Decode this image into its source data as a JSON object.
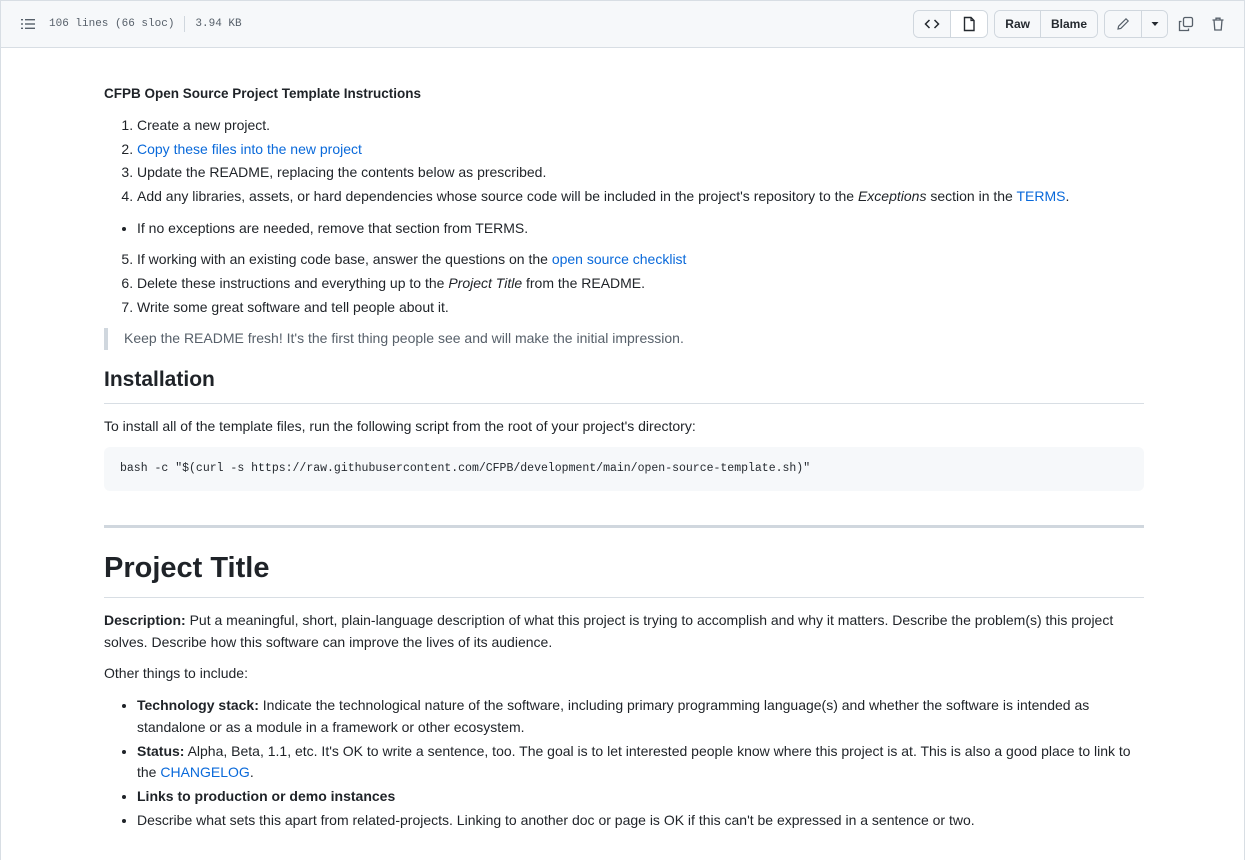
{
  "file_header": {
    "lines": "106 lines (66 sloc)",
    "size": "3.94 KB",
    "raw_label": "Raw",
    "blame_label": "Blame"
  },
  "readme": {
    "intro_title": "CFPB Open Source Project Template Instructions",
    "steps_a": [
      {
        "text": "Create a new project."
      },
      {
        "link": "Copy these files into the new project"
      },
      {
        "text": "Update the README, replacing the contents below as prescribed."
      },
      {
        "before": "Add any libraries, assets, or hard dependencies whose source code will be included in the project's repository to the ",
        "em": "Exceptions",
        "after": " section in the ",
        "link": "TERMS",
        "end": "."
      }
    ],
    "bullet": "If no exceptions are needed, remove that section from TERMS.",
    "steps_b": [
      {
        "before": "If working with an existing code base, answer the questions on the ",
        "link": "open source checklist"
      },
      {
        "before": "Delete these instructions and everything up to the ",
        "em": "Project Title",
        "after": " from the README."
      },
      {
        "text": "Write some great software and tell people about it."
      }
    ],
    "blockquote": "Keep the README fresh! It's the first thing people see and will make the initial impression.",
    "installation_heading": "Installation",
    "installation_text": "To install all of the template files, run the following script from the root of your project's directory:",
    "install_command": "bash -c \"$(curl -s https://raw.githubusercontent.com/CFPB/development/main/open-source-template.sh)\"",
    "project_title": "Project Title",
    "description_label": "Description:",
    "description_text": " Put a meaningful, short, plain-language description of what this project is trying to accomplish and why it matters. Describe the problem(s) this project solves. Describe how this software can improve the lives of its audience.",
    "other_things": "Other things to include:",
    "include_items": [
      {
        "label": "Technology stack:",
        "text": " Indicate the technological nature of the software, including primary programming language(s) and whether the software is intended as standalone or as a module in a framework or other ecosystem."
      },
      {
        "label": "Status:",
        "text": " Alpha, Beta, 1.1, etc. It's OK to write a sentence, too. The goal is to let interested people know where this project is at. This is also a good place to link to the ",
        "link": "CHANGELOG",
        "end": "."
      },
      {
        "label": "Links to production or demo instances"
      },
      {
        "text": "Describe what sets this apart from related-projects. Linking to another doc or page is OK if this can't be expressed in a sentence or two."
      }
    ]
  },
  "colors": {
    "link": "#0969da",
    "text": "#1f2328",
    "muted": "#57606a",
    "border": "#d0d7de"
  },
  "icons": [
    "list-outline-icon",
    "code-icon",
    "file-icon",
    "pencil-icon",
    "caret-down-icon",
    "copy-icon",
    "trash-icon"
  ]
}
